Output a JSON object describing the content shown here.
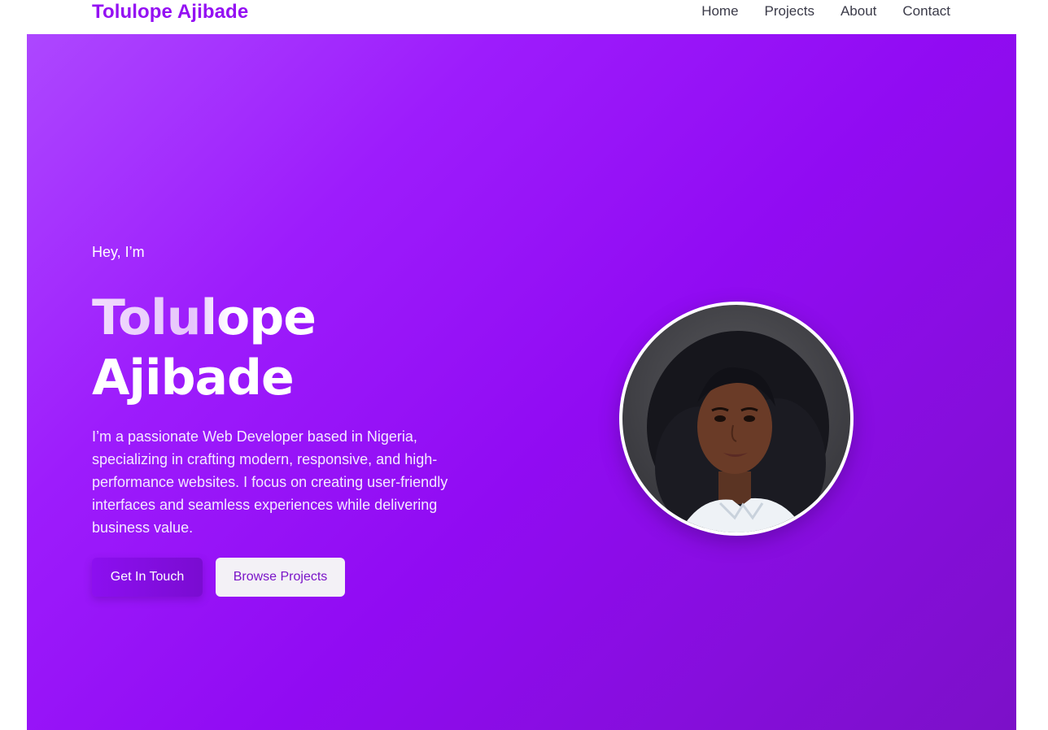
{
  "header": {
    "brand": "Tolulope Ajibade",
    "nav": [
      "Home",
      "Projects",
      "About",
      "Contact"
    ]
  },
  "hero": {
    "greeting": "Hey, I’m",
    "name_line1": "Tolulope",
    "name_line2": "Ajibade",
    "bio": "I’m a passionate Web Developer based in Nigeria, specializing in crafting modern, responsive, and high-performance websites. I focus on creating user-friendly interfaces and seamless experiences while delivering business value.",
    "primary_button": "Get In Touch",
    "secondary_button": "Browse Projects",
    "avatar_icon": "profile-photo"
  },
  "colors": {
    "brand": "#9410f3",
    "hero_gradient_start": "#ad47ff",
    "hero_gradient_end": "#7c10c8",
    "secondary_button_text": "#7a14c8"
  }
}
